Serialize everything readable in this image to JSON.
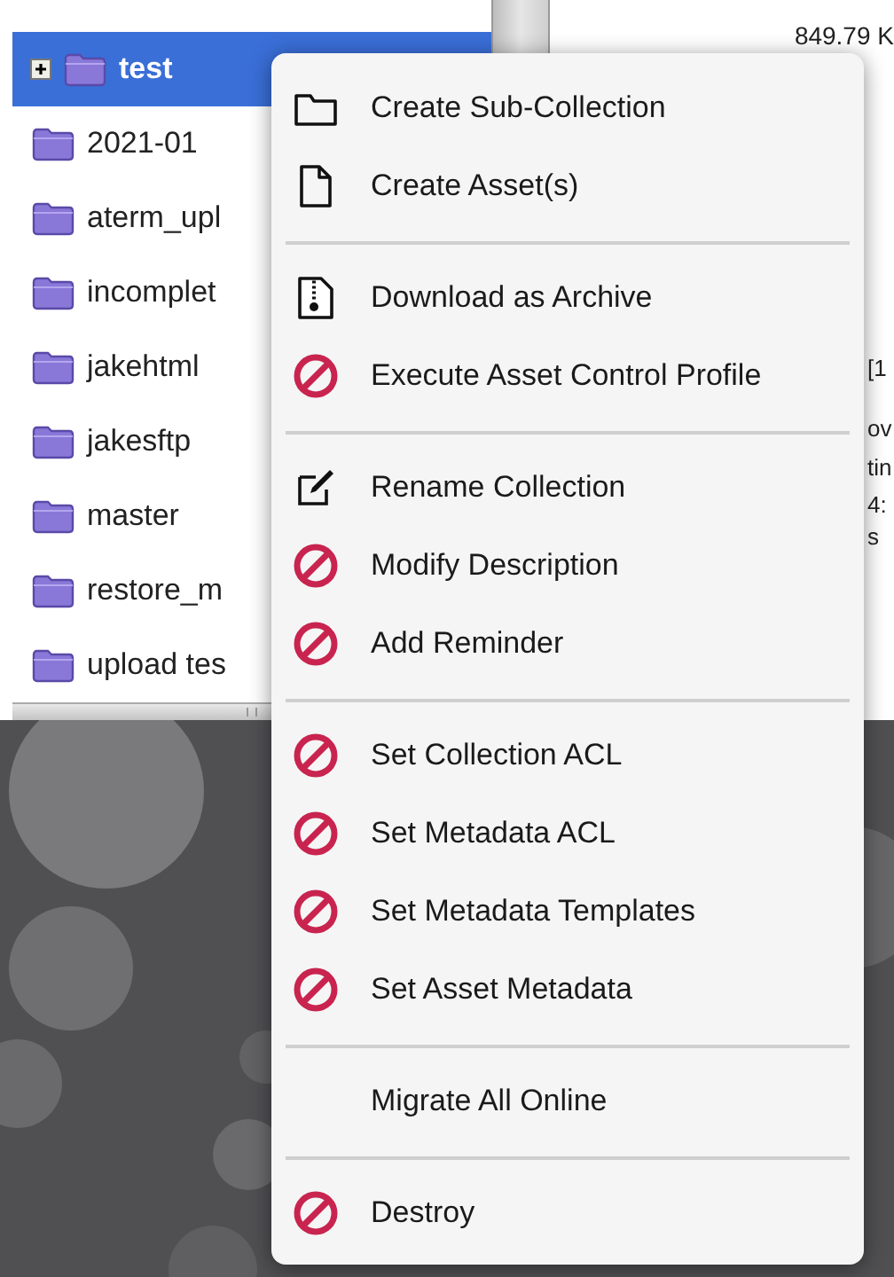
{
  "tree": {
    "items": [
      {
        "label": "test",
        "selected": true,
        "expandable": true
      },
      {
        "label": "2021-01",
        "selected": false,
        "expandable": false
      },
      {
        "label": "aterm_upl",
        "selected": false,
        "expandable": false
      },
      {
        "label": "incomplet",
        "selected": false,
        "expandable": false
      },
      {
        "label": "jakehtml",
        "selected": false,
        "expandable": false
      },
      {
        "label": "jakesftp",
        "selected": false,
        "expandable": false
      },
      {
        "label": "master",
        "selected": false,
        "expandable": false
      },
      {
        "label": "restore_m",
        "selected": false,
        "expandable": false
      },
      {
        "label": "upload tes",
        "selected": false,
        "expandable": false
      }
    ]
  },
  "details": {
    "size": "849.79 K",
    "fragments": [
      "[1",
      "ov",
      "tin",
      "4:",
      "s"
    ]
  },
  "context_menu": {
    "groups": [
      {
        "items": [
          {
            "label": "Create Sub-Collection",
            "kind": "folder"
          },
          {
            "label": "Create Asset(s)",
            "kind": "file"
          }
        ]
      },
      {
        "items": [
          {
            "label": "Download as Archive",
            "kind": "archive"
          },
          {
            "label": "Execute Asset Control Profile",
            "kind": "blocked"
          }
        ]
      },
      {
        "items": [
          {
            "label": "Rename Collection",
            "kind": "edit"
          },
          {
            "label": "Modify Description",
            "kind": "blocked"
          },
          {
            "label": "Add Reminder",
            "kind": "blocked"
          }
        ]
      },
      {
        "items": [
          {
            "label": "Set Collection ACL",
            "kind": "blocked"
          },
          {
            "label": "Set Metadata ACL",
            "kind": "blocked"
          },
          {
            "label": "Set Metadata Templates",
            "kind": "blocked"
          },
          {
            "label": "Set Asset Metadata",
            "kind": "blocked"
          }
        ]
      },
      {
        "items": [
          {
            "label": "Migrate All Online",
            "kind": "plain"
          }
        ]
      },
      {
        "items": [
          {
            "label": "Destroy",
            "kind": "blocked"
          }
        ]
      }
    ]
  }
}
